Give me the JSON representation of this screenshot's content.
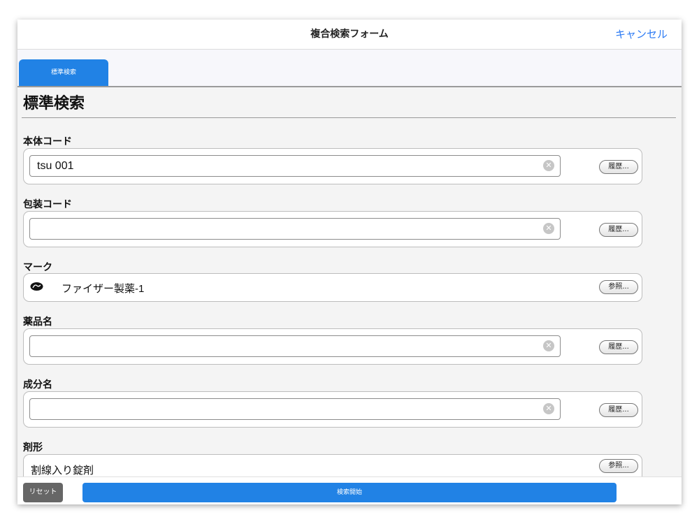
{
  "header": {
    "title": "複合検索フォーム",
    "cancel_label": "キャンセル"
  },
  "tabs": [
    {
      "label": "標準検索",
      "active": true
    }
  ],
  "section": {
    "title": "標準検索"
  },
  "fields": {
    "body_code": {
      "label": "本体コード",
      "value": "tsu 001",
      "placeholder": "",
      "button_label": "履歴..."
    },
    "package_code": {
      "label": "包装コード",
      "value": "",
      "placeholder": "",
      "button_label": "履歴..."
    },
    "mark": {
      "label": "マーク",
      "logo_icon": "pfizer-logo-icon",
      "value": "ファイザー製薬-1",
      "button_label": "参照..."
    },
    "drug_name": {
      "label": "薬品名",
      "value": "",
      "placeholder": "",
      "button_label": "履歴..."
    },
    "ingredient_name": {
      "label": "成分名",
      "value": "",
      "placeholder": "",
      "button_label": "履歴..."
    },
    "dosage_form": {
      "label": "剤形",
      "value": "割線入り錠剤",
      "button_label": "参照..."
    }
  },
  "footer": {
    "reset_label": "リセット",
    "search_label": "検索開始"
  },
  "icons": {
    "clear": "clear-circle-icon",
    "logo": "pfizer-logo-icon"
  },
  "colors": {
    "accent": "#2182e5",
    "link": "#2d7bf4",
    "reset": "#666666"
  }
}
